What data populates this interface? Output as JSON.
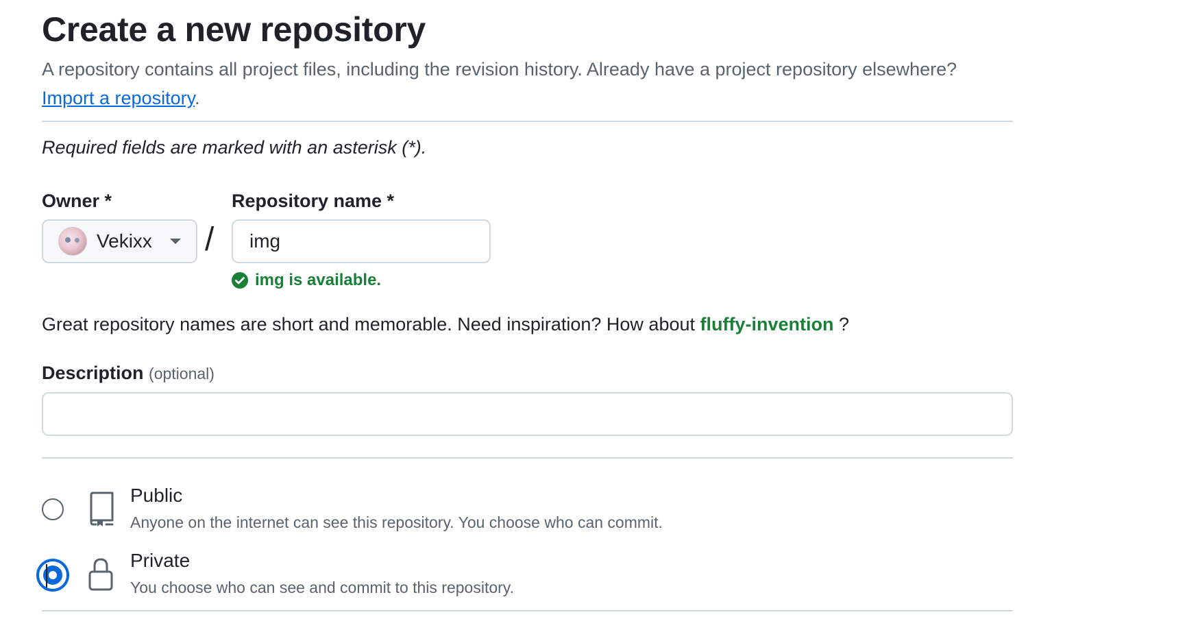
{
  "header": {
    "title": "Create a new repository",
    "subtitle": "A repository contains all project files, including the revision history. Already have a project repository elsewhere?",
    "import_link": "Import a repository",
    "import_suffix": "."
  },
  "form": {
    "required_note": "Required fields are marked with an asterisk (*).",
    "owner": {
      "label": "Owner *",
      "value": "Vekixx",
      "avatar_icon": "user-avatar"
    },
    "separator": "/",
    "repo_name": {
      "label": "Repository name *",
      "value": "img"
    },
    "availability": {
      "icon": "check-circle-fill-icon",
      "text": "img is available.",
      "color": "#1a7f37"
    },
    "suggestion": {
      "prefix": "Great repository names are short and memorable. Need inspiration? How about",
      "name": "fluffy-invention",
      "suffix": "?"
    },
    "description": {
      "label": "Description",
      "optional": "(optional)",
      "value": ""
    },
    "visibility": {
      "options": [
        {
          "title": "Public",
          "description": "Anyone on the internet can see this repository. You choose who can commit.",
          "icon": "repo-icon",
          "selected": false
        },
        {
          "title": "Private",
          "description": "You choose who can see and commit to this repository.",
          "icon": "lock-icon",
          "selected": true
        }
      ]
    }
  },
  "colors": {
    "text": "#1f2328",
    "muted": "#59636e",
    "link": "#0969da",
    "success": "#1a7f37",
    "border": "#d1d9e0"
  }
}
